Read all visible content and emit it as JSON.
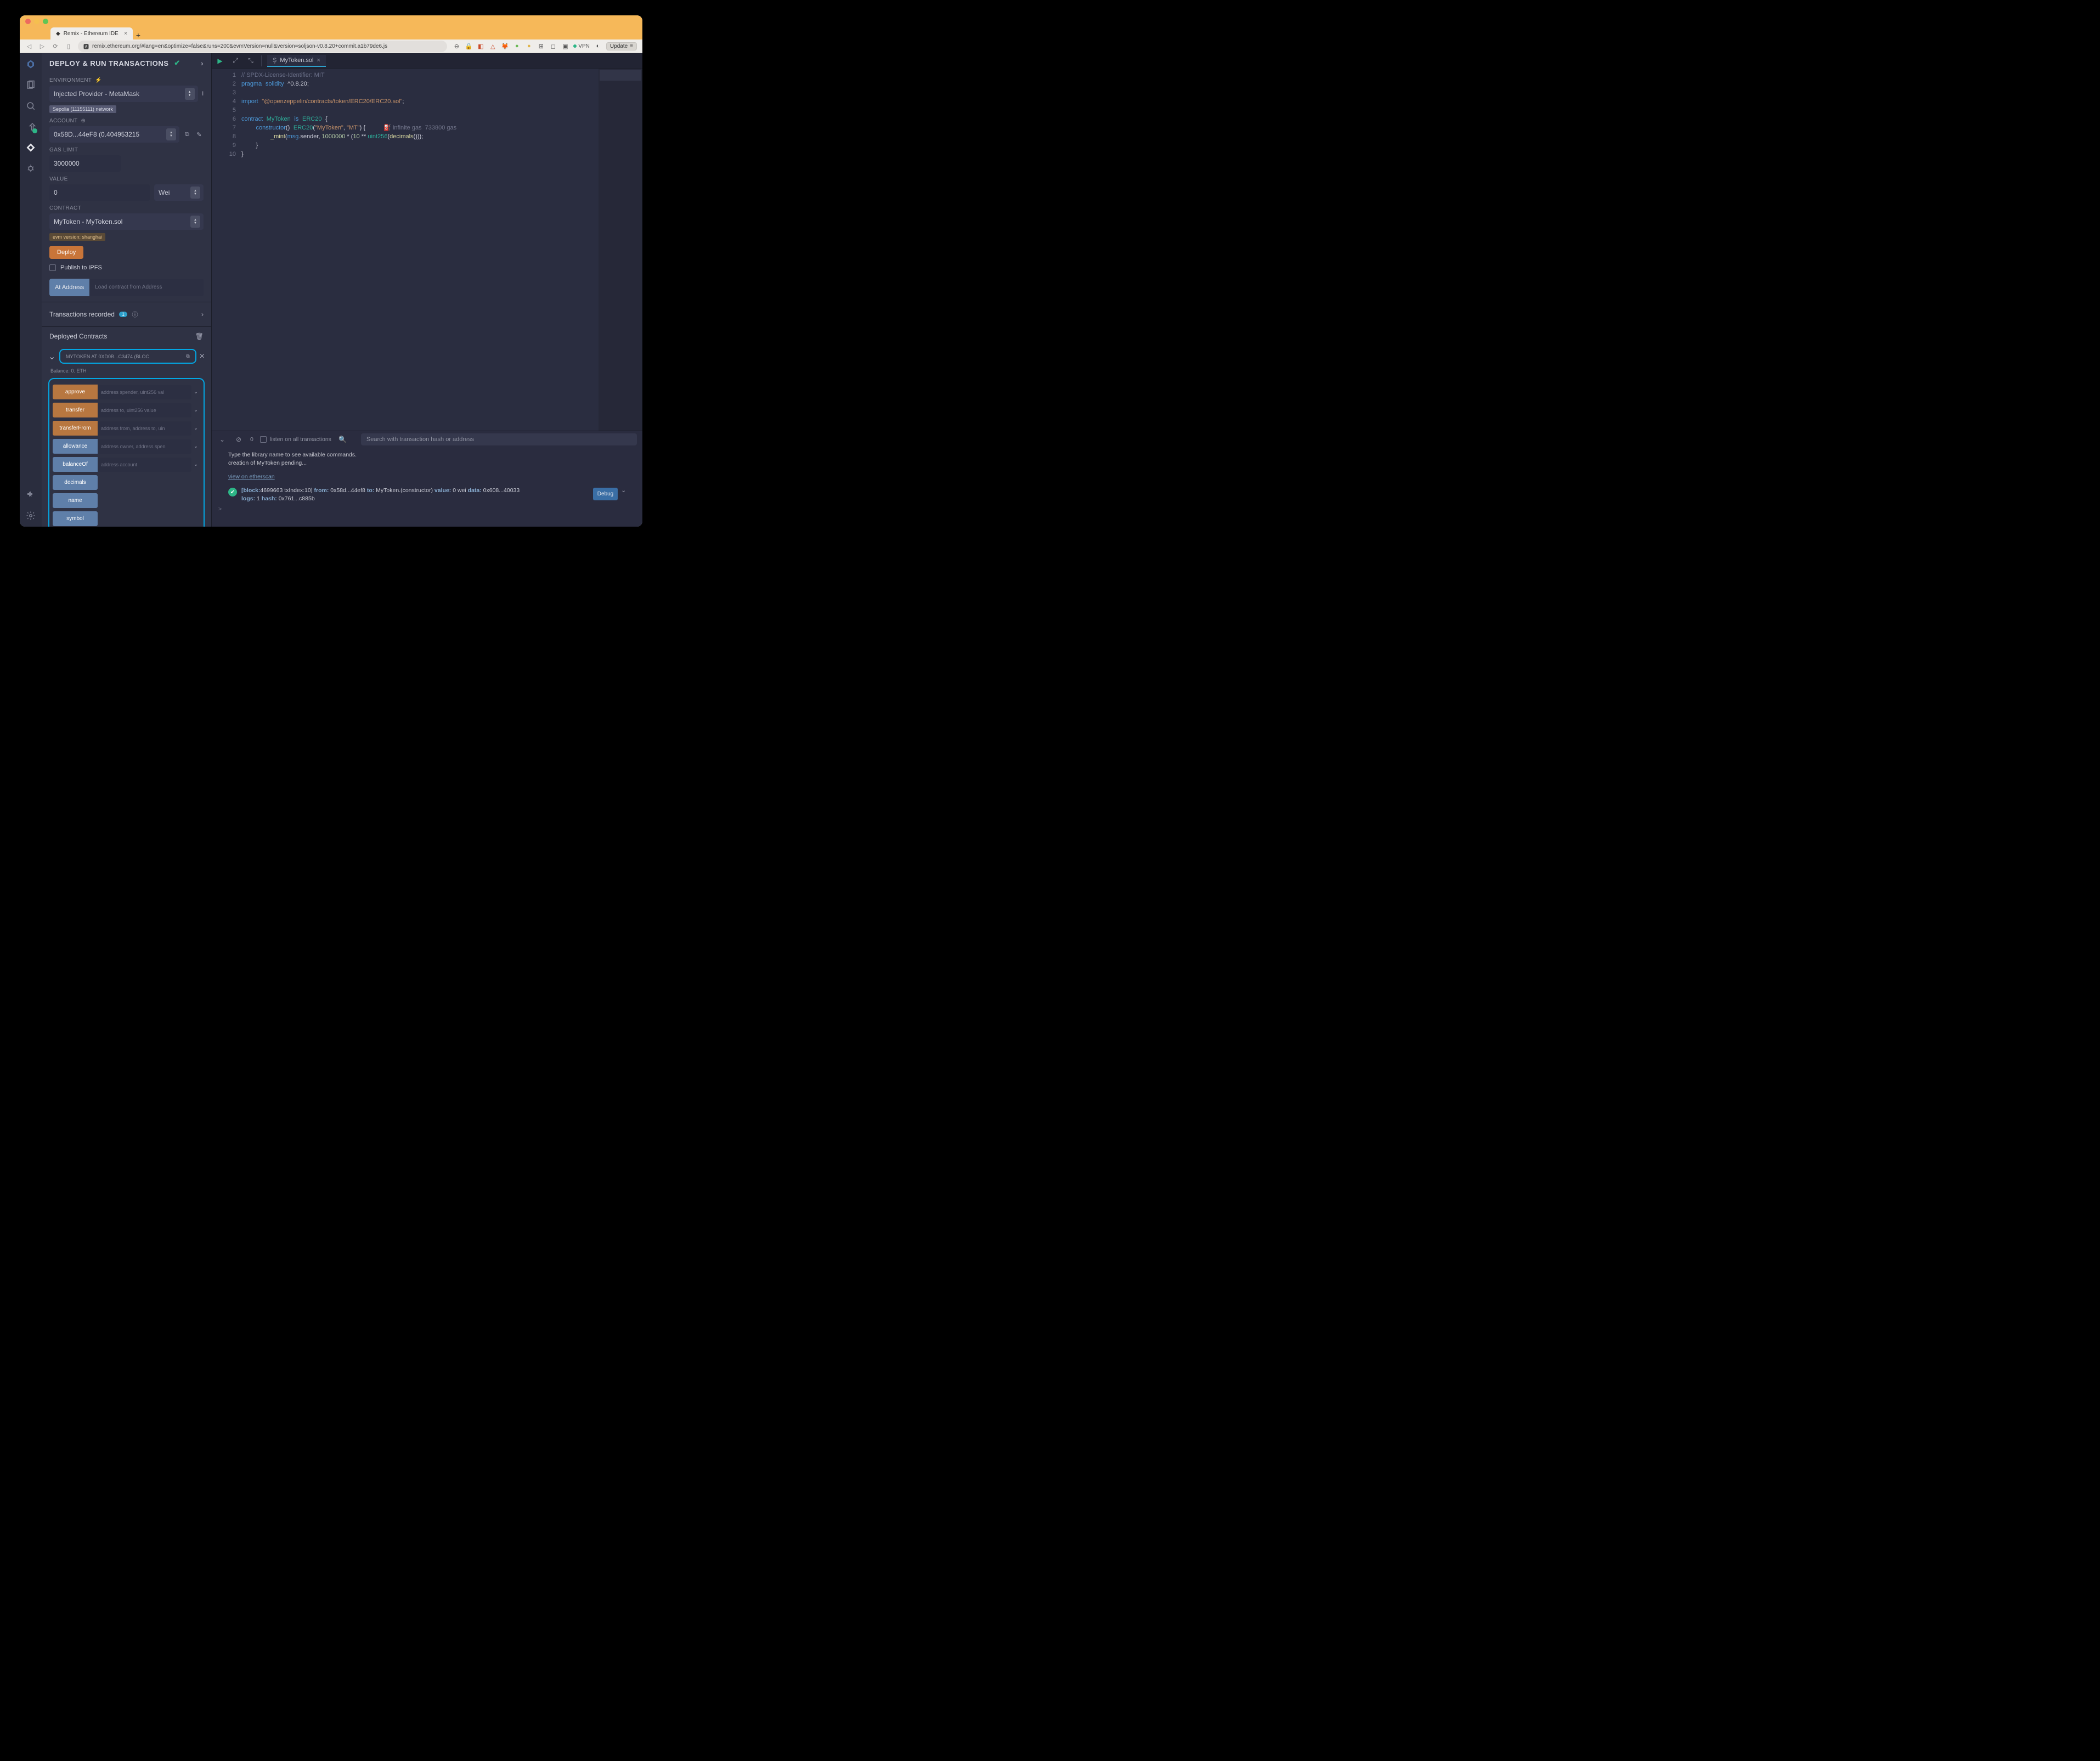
{
  "browser": {
    "tab_title": "Remix - Ethereum IDE",
    "newtab_label": "+",
    "url": "remix.ethereum.org/#lang=en&optimize=false&runs=200&evmVersion=null&version=soljson-v0.8.20+commit.a1b79de6.js",
    "update_label": "Update",
    "vpn_label": "VPN"
  },
  "panel": {
    "title": "DEPLOY & RUN TRANSACTIONS",
    "env_label": "ENVIRONMENT",
    "env_value": "Injected Provider - MetaMask",
    "network_chip": "Sepolia (11155111) network",
    "account_label": "ACCOUNT",
    "account_value": "0x58D...44eF8 (0.404953215",
    "gas_label": "GAS LIMIT",
    "gas_value": "3000000",
    "value_label": "VALUE",
    "value_amount": "0",
    "value_unit": "Wei",
    "contract_label": "CONTRACT",
    "contract_value": "MyToken - MyToken.sol",
    "evm_chip": "evm version: shanghai",
    "deploy_label": "Deploy",
    "publish_label": "Publish to IPFS",
    "at_address_label": "At Address",
    "at_address_placeholder": "Load contract from Address",
    "tx_recorded_label": "Transactions recorded",
    "tx_count": "1",
    "deployed_title": "Deployed Contracts",
    "instance_name": "MYTOKEN AT 0XD0B...C3474 (BLOC",
    "balance_label": "Balance: 0. ETH",
    "functions": [
      {
        "name": "approve",
        "type": "orange",
        "args": "address spender, uint256 val",
        "expand": true
      },
      {
        "name": "transfer",
        "type": "orange",
        "args": "address to, uint256 value",
        "expand": true
      },
      {
        "name": "transferFrom",
        "type": "orange",
        "args": "address from, address to, uin",
        "expand": true
      },
      {
        "name": "allowance",
        "type": "blue",
        "args": "address owner, address spen",
        "expand": true
      },
      {
        "name": "balanceOf",
        "type": "blue",
        "args": "address account",
        "expand": true
      },
      {
        "name": "decimals",
        "type": "blue",
        "args": null,
        "expand": false
      },
      {
        "name": "name",
        "type": "blue",
        "args": null,
        "expand": false
      },
      {
        "name": "symbol",
        "type": "blue",
        "args": null,
        "expand": false
      }
    ]
  },
  "editor": {
    "tab_name": "MyToken.sol",
    "line_numbers": [
      "1",
      "2",
      "3",
      "4",
      "5",
      "6",
      "7",
      "8",
      "9",
      "10"
    ],
    "code": {
      "l1_cmt": "// SPDX-License-Identifier: MIT",
      "l2_a": "pragma",
      "l2_b": "solidity",
      "l2_c": "^0.8.20;",
      "l4_a": "import",
      "l4_b": "\"@openzeppelin/contracts/token/ERC20/ERC20.sol\"",
      "l4_c": ";",
      "l6_a": "contract",
      "l6_b": "MyToken",
      "l6_c": "is",
      "l6_d": "ERC20",
      "l6_e": "{",
      "l7_a": "constructor",
      "l7_b": "()",
      "l7_c": "ERC20",
      "l7_d": "(",
      "l7_e": "\"MyToken\"",
      "l7_f": ", ",
      "l7_g": "\"MT\"",
      "l7_h": ") {",
      "l7_gas": "infinite gas  733800 gas",
      "l8_a": "_mint",
      "l8_b": "(",
      "l8_c": "msg",
      "l8_d": ".sender, ",
      "l8_e": "1000000",
      "l8_f": " * (",
      "l8_g": "10",
      "l8_h": " ** ",
      "l8_i": "uint256",
      "l8_j": "(",
      "l8_k": "decimals",
      "l8_l": "()));",
      "l9": "}",
      "l10": "}"
    }
  },
  "terminal": {
    "count": "0",
    "listen_label": "listen on all transactions",
    "search_placeholder": "Search with transaction hash or address",
    "line1": "Type the library name to see available commands.",
    "line2": "creation of MyToken pending...",
    "etherscan_link": "view on etherscan",
    "log": {
      "blk_label": "[block:",
      "blk_val": "4699663 txIndex:10]",
      "from_label": " from:",
      "from_val": " 0x58d...44ef8",
      "to_label": " to:",
      "to_val": " MyToken.(constructor)",
      "value_label": " value:",
      "value_val": " 0 wei",
      "data_label": " data:",
      "data_val": " 0x608...40033",
      "logs_label": "logs:",
      "logs_val": " 1",
      "hash_label": " hash:",
      "hash_val": " 0x761...c885b"
    },
    "debug_label": "Debug",
    "caret": ">"
  }
}
